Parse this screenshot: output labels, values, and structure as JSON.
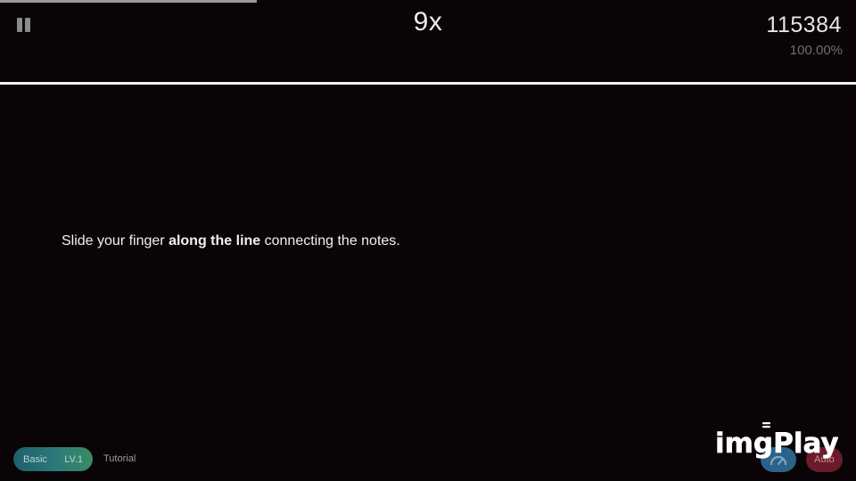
{
  "progress": {
    "fraction": 0.3
  },
  "hud": {
    "combo": "9x",
    "score": "115384",
    "accuracy": "100.00%",
    "pause_icon": "pause-icon"
  },
  "instruction": {
    "before": "Slide your finger ",
    "bold": "along the line",
    "after": " connecting the notes."
  },
  "footer": {
    "difficulty": "Basic",
    "level": "LV.1",
    "chart_title": "Tutorial",
    "speed_icon": "speedometer-icon",
    "auto_label": "Auto"
  },
  "watermark": {
    "text": "imgPlay"
  },
  "colors": {
    "background": "#0a0407",
    "judge_line": "#f2f2f2",
    "level_pill_start": "#1e5f6c",
    "level_pill_end": "#3a8b63",
    "speed_button": "#2c6287",
    "auto_button": "#6b1c2a"
  }
}
